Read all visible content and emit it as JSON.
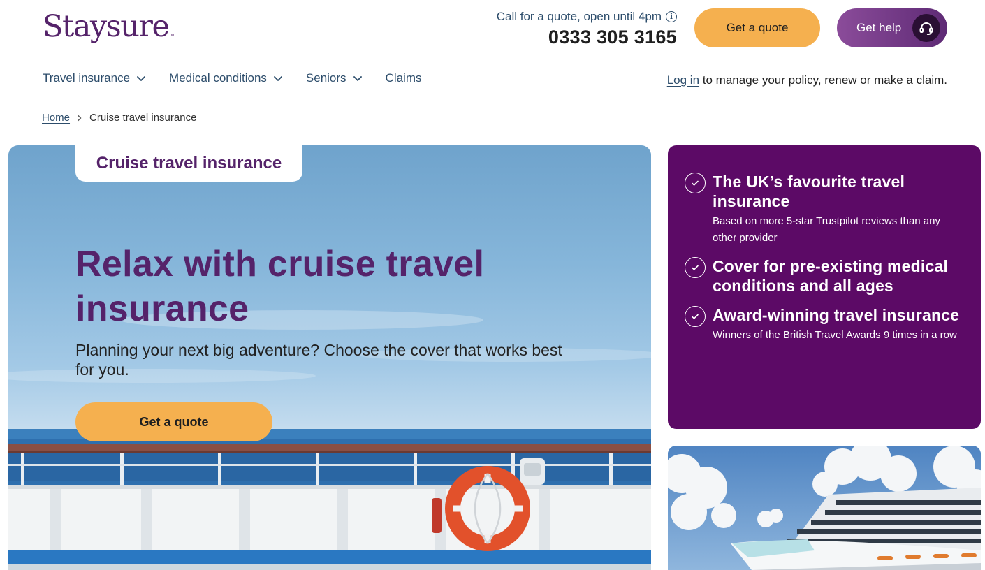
{
  "brand": {
    "name": "Staysure",
    "trademark": "™",
    "primary_color": "#55236a",
    "accent_color": "#f5b04f",
    "panel_color": "#5c0a66"
  },
  "header": {
    "call_label": "Call for a quote, open until 4pm",
    "phone": "0333 305 3165",
    "quote_button": "Get a quote",
    "help_button": "Get help"
  },
  "nav": {
    "items": [
      {
        "label": "Travel insurance",
        "has_dropdown": true
      },
      {
        "label": "Medical conditions",
        "has_dropdown": true
      },
      {
        "label": "Seniors",
        "has_dropdown": true
      },
      {
        "label": "Claims",
        "has_dropdown": false
      }
    ],
    "login_link": "Log in",
    "login_text": " to manage your policy, renew or make a claim."
  },
  "breadcrumb": {
    "home": "Home",
    "current": "Cruise travel insurance"
  },
  "hero": {
    "tag": "Cruise travel insurance",
    "title": "Relax with cruise travel insurance",
    "subtitle": "Planning your next big adventure? Choose the cover that works best for you.",
    "cta": "Get a quote"
  },
  "benefits": [
    {
      "title": "The UK’s favourite travel insurance",
      "desc": "Based on more 5-star Trustpilot reviews than any other provider"
    },
    {
      "title": "Cover for pre-existing medical conditions and all ages",
      "desc": ""
    },
    {
      "title": "Award-winning travel insurance",
      "desc": "Winners of the British Travel Awards 9 times in a row"
    }
  ],
  "icons": {
    "info": "info-icon",
    "help": "headset-icon",
    "chevron": "chevron-down-icon",
    "check": "check-circle-icon"
  }
}
